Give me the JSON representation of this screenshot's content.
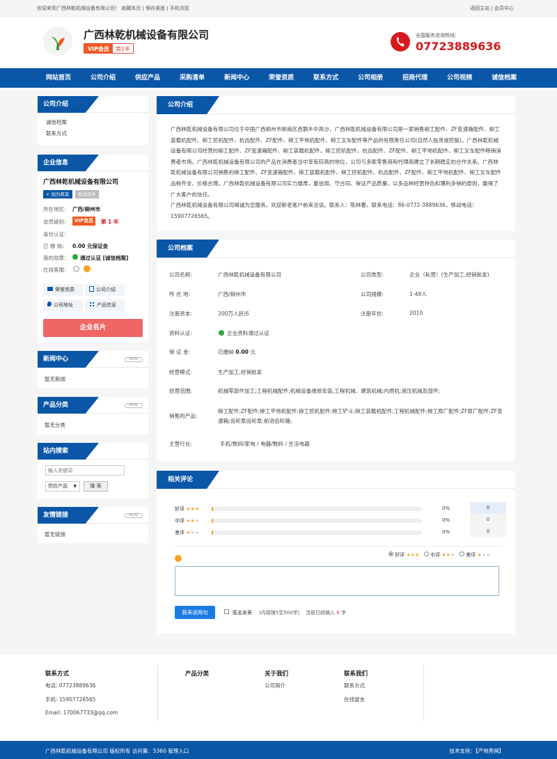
{
  "topbar": {
    "left": "欢迎来到广西林乾机械设备有限公司！  收藏本页  |  保存桌面  |  手机浏览",
    "right": "返回主站  |  会员中心"
  },
  "header": {
    "company": "广西林乾机械设备有限公司",
    "vip_label": "VIP会员",
    "year": "第1年",
    "hotline_label": "全国服务咨询热线:",
    "hotline": "07723889636"
  },
  "nav": [
    "网站首页",
    "公司介绍",
    "供应产品",
    "采购清单",
    "新闻中心",
    "荣誉资质",
    "联系方式",
    "公司相册",
    "招商代理",
    "公司视频",
    "诚信档案"
  ],
  "sidebar": {
    "intro": {
      "title": "公司介绍",
      "links": [
        "诚信档案",
        "联系方式"
      ]
    },
    "info": {
      "title": "企业信息",
      "name": "广西林乾机械设备有限公司",
      "btn_add": "+ 加为商友",
      "btn_msg": "发送信件",
      "region_label": "所在地区：",
      "region": "广西/柳州市",
      "level_label": "会员级别：",
      "level_vip": "VIP会员",
      "level_year": "第 1 年",
      "auth_label": "身份认证：",
      "deposit_label": "已 缴 纳：",
      "deposit": "0.00 元保证金",
      "seal_label": "我的勋章：",
      "seal": "通过认证 [诚信档案]",
      "service_label": "在线客服：",
      "grid": [
        "荣誉资质",
        "公司介绍",
        "公司地址",
        "产品信息"
      ],
      "card_btn": "企业名片"
    },
    "news": {
      "title": "新闻中心",
      "more": "MORE",
      "empty": "暂无新闻"
    },
    "category": {
      "title": "产品分类",
      "more": "MORE",
      "empty": "暂无分类"
    },
    "search": {
      "title": "站内搜索",
      "placeholder": "输入关键词",
      "select": "供应产品",
      "button": "搜 索"
    },
    "links": {
      "title": "友情链接",
      "more": "MORE",
      "empty": "暂无链接"
    }
  },
  "intro_panel": {
    "title": "公司介绍",
    "text": "广西林乾机械设备有限公司位于中国广西柳州市柳南区西鹅乡中高沙，广西林乾机械设备有限公司是一家销售柳工配件、ZF变速箱配件、柳工装载机配件、柳工挖机配件、杭齿配件、ZF配件、柳工平地机配件、柳工叉车配件等产品的有限责任公司(自然人投资或控股)。广西林乾机械设备有限公司经营的柳工配件、ZF变速箱配件、柳工装载机配件、柳工挖机配件、杭齿配件、ZF配件、柳工平地机配件、柳工叉车配件畅销消费者市场。广西林乾机械设备有限公司的产品在消费者当中享有较高的地位，公司与多家零售商和代理商建立了长期稳定的合作关系。广西林乾机械设备有限公司销售的柳工配件、ZF变速箱配件、柳工装载机配件、柳工挖机配件、杭齿配件、ZF配件、柳工平地机配件、柳工叉车配件品种齐全、价格合理。广西林乾机械设备有限公司实力雄厚，重信用、守合同、保证产品质量，以多品种经营特色和薄利多销的原则，赢得了广大客户的信任。",
    "contact": "广西林乾机械设备有限公司竭诚为您服务，欢迎新老客户前来洽谈。联系人：陈林春，联系电话：86-0772-3889636，移动电话：15907726565。"
  },
  "archive": {
    "title": "公司档案",
    "name_label": "公司名称:",
    "name": "广西林乾机械设备有限公司",
    "type_label": "公司类型:",
    "type": "企业（私营）(生产加工,经销批发)",
    "loc_label": "所 在 地:",
    "loc": "广西/柳州市",
    "size_label": "公司规模:",
    "size": "1-49人",
    "capital_label": "注册资本:",
    "capital": "200万人民币",
    "year_label": "注册年份:",
    "year": "2010",
    "cert_label": "资料认证:",
    "cert": "企业资料通过认证",
    "deposit_label": "保 证 金:",
    "deposit_pre": "已缴纳",
    "deposit_val": "0.00",
    "deposit_unit": "元",
    "mode_label": "经营模式:",
    "mode": "生产加工,经销批发",
    "scope_label": "经营范围:",
    "scope": "机械零部件加工;工程机械配件;机械设备维修安装;工程机械、建筑机械;内燃机;液压机械及部件;",
    "products_label": "销售的产品:",
    "products": "柳工配件;ZF配件;柳工平地机配件;柳工挖机配件;柳工铲斗;柳工装载机配件;工程机械配件;柳工原厂配件;ZF原厂配件;ZF变速箱;齿轮泵齿轮泵;前进齿轮箱;",
    "industry_label": "主营行业:",
    "industry": "手机/数码/家电 / 电器/数码 / 生活电器"
  },
  "reviews": {
    "title": "相关评论",
    "rows": [
      {
        "label": "好评",
        "pct": "0%",
        "count": "0"
      },
      {
        "label": "中评",
        "pct": "0%",
        "count": "0"
      },
      {
        "label": "差评",
        "pct": "0%",
        "count": "0"
      }
    ],
    "radio": [
      "好评",
      "中评",
      "差评"
    ],
    "submit": "我来说两句",
    "anon": "匿名发表",
    "limit": "(内容限5至500字)",
    "typed_pre": "当前已经输入",
    "typed_val": "0",
    "typed_unit": "字"
  },
  "footer": {
    "contact_title": "联系方式",
    "tel": "电话: 07723889636",
    "mobile": "手机: 15907726565",
    "email": "Email: 170067733@qq.com",
    "cat_title": "产品分类",
    "about_title": "关于我们",
    "about_link": "公司简介",
    "contact2_title": "联系我们",
    "contact2_links": [
      "联系方式",
      "在线留言"
    ]
  },
  "copyright": {
    "left": "广西林乾机械设备有限公司 版权所有   访问量：5360   管理入口",
    "right": "技术支持：【产地秀网】"
  },
  "colors": {
    "brand": "#0a56a7",
    "accent": "#d7191f",
    "vip": "#f15a22",
    "star": "#f5a623"
  }
}
